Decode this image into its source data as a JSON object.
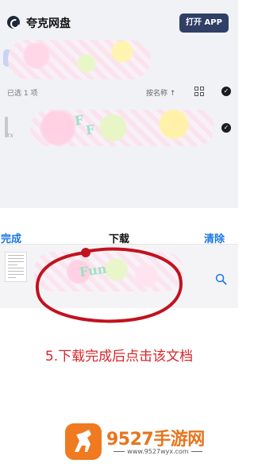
{
  "app": {
    "name": "夸克网盘",
    "open_app_label": "打开 APP"
  },
  "file_list": {
    "selected_count": "已选 1 项",
    "sort_label": "按名称 ↑",
    "check_glyph": "✓",
    "row_tag": "TX"
  },
  "download_sheet": {
    "done_label": "完成",
    "title": "下载",
    "clear_label": "清除"
  },
  "annotation": {
    "instruction": "5.下载完成后点击该文档",
    "circle_color": "#c1121f"
  },
  "watermark": {
    "name": "9527手游网",
    "url": "www.9527wyx.com"
  },
  "colors": {
    "link_blue": "#1976e6",
    "open_app_bg": "#2f3f66",
    "instruction_red": "#d8252a",
    "brand_orange": "#e8741c"
  },
  "icons": {
    "logo": "quark-logo-icon",
    "grid": "grid-view-icon",
    "check": "checkmark-icon",
    "search": "search-icon",
    "document": "document-thumbnail-icon",
    "brand": "horse-logo-icon"
  }
}
